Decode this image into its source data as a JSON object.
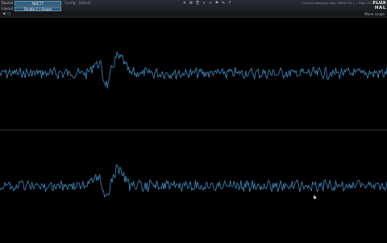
{
  "header": {
    "source_label": "Source",
    "source_value": "NUCT7",
    "layout_label": "Layout",
    "layout_value": "Studio C | Scope",
    "config_text": "Config - Default",
    "status_text": "Current sampling rate: 48000 Hz | — Stat: 32 bits Float",
    "logo_top": "FLUX",
    "logo_bottom": "HAL"
  },
  "toolbar": {
    "icons": [
      "cross-icon",
      "gear-icon",
      "clipboard-icon",
      "rewind-icon",
      "forward-icon",
      "flag-icon",
      "tools-icon",
      "help-icon"
    ],
    "glyphs": [
      "✕",
      "⚙",
      "⎘",
      "«",
      "»",
      "⚑",
      "✎",
      "?"
    ]
  },
  "subbar": {
    "left_glyphs": [
      "◀",
      "□"
    ],
    "right_text": "Wave scope"
  },
  "colors": {
    "trace": "#3f8fc4",
    "background": "#000000"
  }
}
